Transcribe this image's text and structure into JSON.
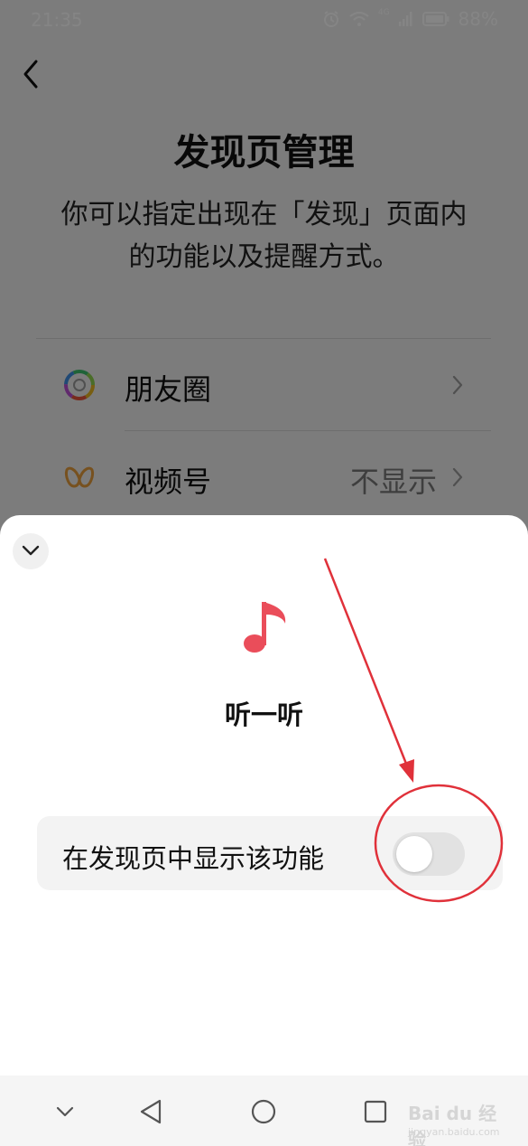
{
  "status_bar": {
    "time": "21:35",
    "network": "4G",
    "battery": "88%"
  },
  "page": {
    "title": "发现页管理",
    "description_line1": "你可以指定出现在「发现」页面内",
    "description_line2": "的功能以及提醒方式。"
  },
  "list": {
    "items": [
      {
        "label": "朋友圈",
        "value": "",
        "icon": "moments-aperture-icon"
      },
      {
        "label": "视频号",
        "value": "不显示",
        "icon": "channels-butterfly-icon"
      }
    ]
  },
  "sheet": {
    "icon": "music-note-icon",
    "title": "听一听",
    "setting_label": "在发现页中显示该功能",
    "toggle_on": false
  },
  "watermark": {
    "text": "Bai du 经验",
    "sub": "jingyan.baidu.com"
  },
  "colors": {
    "accent_red": "#e0313a",
    "music_icon": "#ea4d5a"
  }
}
